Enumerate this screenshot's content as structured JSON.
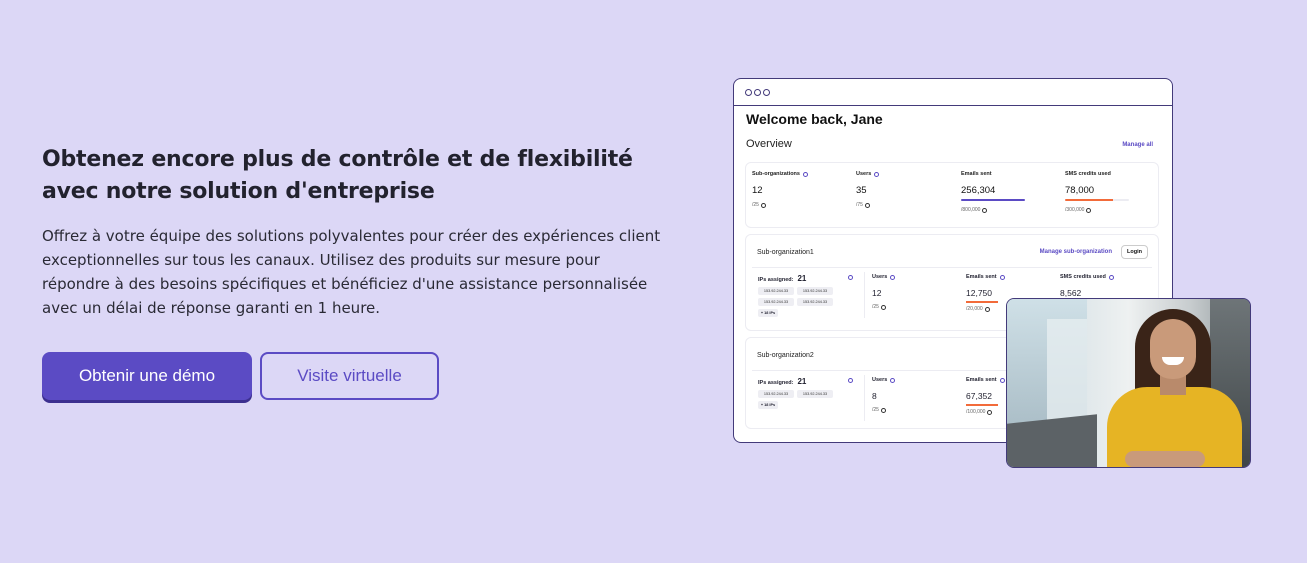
{
  "hero": {
    "title": "Obtenez encore plus de contrôle et de flexibilité avec notre solution d'entreprise",
    "description": "Offrez à votre équipe des solutions polyvalentes pour créer des expériences client exceptionnelles sur tous les canaux. Utilisez des produits sur mesure pour répondre à des besoins spécifiques et bénéficiez d'une assistance personnalisée avec un délai de réponse garanti en 1 heure.",
    "primary_button": "Obtenir une démo",
    "secondary_button": "Visite virtuelle"
  },
  "dashboard": {
    "welcome": "Welcome back, Jane",
    "overview": "Overview",
    "manage_all": "Manage all",
    "stats": [
      {
        "label": "Sub-organizations",
        "value": "12",
        "limit": "/25",
        "bar_color": "",
        "bar_fill": 0
      },
      {
        "label": "Users",
        "value": "35",
        "limit": "/75",
        "bar_color": "",
        "bar_fill": 0
      },
      {
        "label": "Emails sent",
        "value": "256,304",
        "limit": "/800,000",
        "bar_color": "#5b4bc4",
        "bar_fill": 1
      },
      {
        "label": "SMS credits used",
        "value": "78,000",
        "limit": "/300,000",
        "bar_color": "#f26b3a",
        "bar_fill": 0.75
      }
    ],
    "sub_orgs": [
      {
        "title": "Sub-organization1",
        "manage": "Manage sub-organization",
        "login": "Login",
        "ips_label": "IPs assigned:",
        "ips_count": "21",
        "ips": [
          "153.92.244.33",
          "153.92.244.33",
          "153.92.244.33",
          "153.92.244.33"
        ],
        "more": "+ 18 IPs",
        "users_label": "Users",
        "users_value": "12",
        "users_limit": "/25",
        "emails_label": "Emails sent",
        "emails_value": "12,750",
        "emails_limit": "/20,000",
        "sms_label": "SMS credits used",
        "sms_value": "8,562"
      },
      {
        "title": "Sub-organization2",
        "ips_label": "IPs assigned:",
        "ips_count": "21",
        "ips": [
          "153.92.244.33",
          "153.92.244.33"
        ],
        "more": "+ 18 IPs",
        "users_label": "Users",
        "users_value": "8",
        "users_limit": "/25",
        "emails_label": "Emails sent",
        "emails_value": "67,352",
        "emails_limit": "/100,000"
      }
    ]
  },
  "colors": {
    "background": "#dcd7f6",
    "accent": "#5b4bc4",
    "orange": "#f26b3a"
  }
}
